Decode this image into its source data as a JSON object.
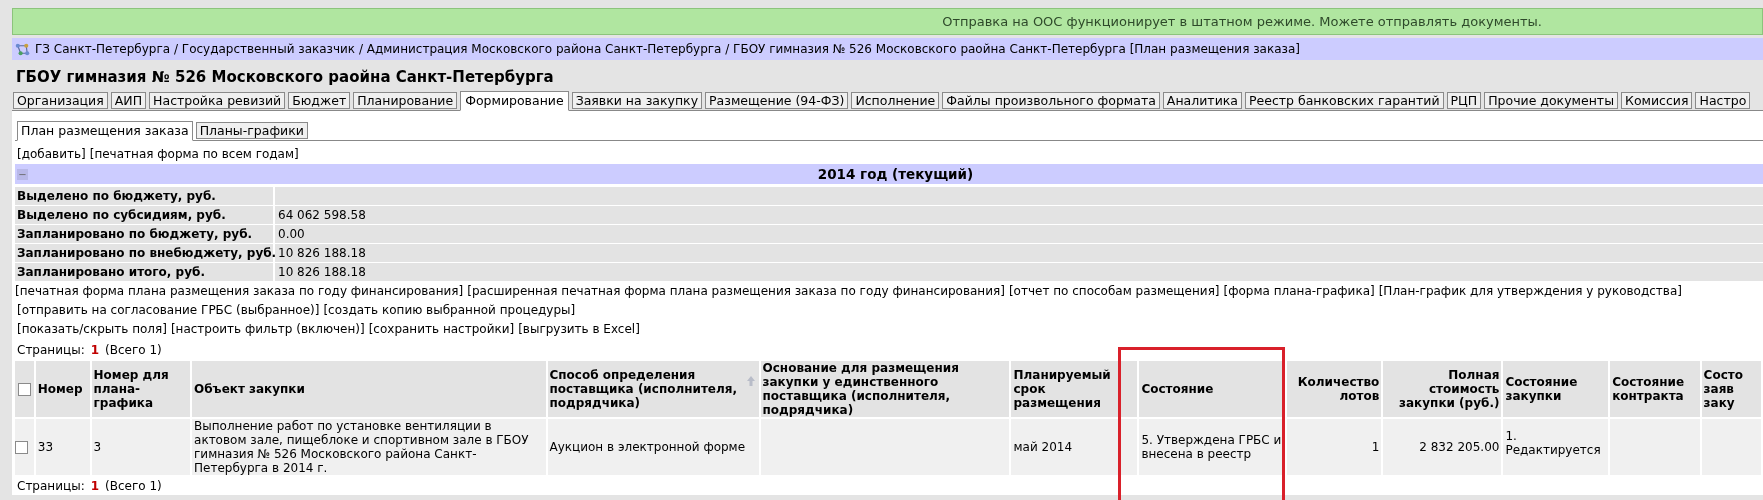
{
  "notice": "Отправка на ООС функционирует в штатном режиме. Можете отправлять документы.",
  "breadcrumb": "ГЗ Санкт-Петербурга / Государственный заказчик / Администрация Московского района Санкт-Петербурга / ГБОУ гимназия № 526 Московского раойна Санкт-Петербурга [План размещения заказа]",
  "org_title": "ГБОУ гимназия № 526 Московского раойна Санкт-Петербурга",
  "tabs": [
    {
      "label": "Организация",
      "selected": false
    },
    {
      "label": "АИП",
      "selected": false
    },
    {
      "label": "Настройка ревизий",
      "selected": false
    },
    {
      "label": "Бюджет",
      "selected": false
    },
    {
      "label": "Планирование",
      "selected": false
    },
    {
      "label": "Формирование",
      "selected": true
    },
    {
      "label": "Заявки на закупку",
      "selected": false
    },
    {
      "label": "Размещение (94-ФЗ)",
      "selected": false
    },
    {
      "label": "Исполнение",
      "selected": false
    },
    {
      "label": "Файлы произвольного формата",
      "selected": false
    },
    {
      "label": "Аналитика",
      "selected": false
    },
    {
      "label": "Реестр банковских гарантий",
      "selected": false
    },
    {
      "label": "РЦП",
      "selected": false
    },
    {
      "label": "Прочие документы",
      "selected": false
    },
    {
      "label": "Комиссия",
      "selected": false
    },
    {
      "label": "Настро",
      "selected": false
    }
  ],
  "subtabs": [
    {
      "label": "План размещения заказа",
      "selected": true
    },
    {
      "label": "Планы-графики",
      "selected": false
    }
  ],
  "top_links": [
    "[добавить]",
    "[печатная форма по всем годам]"
  ],
  "year_section": {
    "collapse_glyph": "−",
    "title": "2014 год (текущий)",
    "summary": [
      {
        "label": "Выделено по бюджету, руб."
      },
      {
        "label": "Выделено по субсидиям, руб.",
        "value": "64 062 598.58"
      },
      {
        "label": "Запланировано по бюджету, руб.",
        "value": "0.00"
      },
      {
        "label": "Запланировано по внебюджету, руб.",
        "value": "10 826 188.18"
      },
      {
        "label": "Запланировано итого, руб.",
        "value": "10 826 188.18"
      }
    ]
  },
  "link_rows": [
    [
      "[печатная форма плана размещения заказа по году финансирования]",
      "[расширенная печатная форма плана размещения заказа по году финансирования]",
      "[отчет по способам размещения]",
      "[форма плана-графика]",
      "[План-график для утверждения у руководства]"
    ],
    [
      "[отправить на согласование ГРБС (выбранное)]",
      "[создать копию выбранной процедуры]"
    ],
    [
      "[показать/скрыть поля]",
      "[настроить фильтр (включен)]",
      "[сохранить настройки]",
      "[выгрузить в Excel]"
    ]
  ],
  "pager_top": {
    "label": "Страницы:",
    "current": "1",
    "total": "(Всего 1)"
  },
  "table": {
    "select_all_checked": false,
    "columns": [
      {
        "label": "Номер",
        "highlighted": false,
        "sorted": false
      },
      {
        "label": "Номер для плана-графика",
        "highlighted": false,
        "sorted": false
      },
      {
        "label": "Объект закупки",
        "highlighted": false,
        "sorted": false
      },
      {
        "label": "Способ определения поставщика (исполнителя, подрядчика)",
        "highlighted": false,
        "sorted": true
      },
      {
        "label": "Основание для размещения закупки у единственного поставщика (исполнителя, подрядчика)",
        "highlighted": false,
        "sorted": false
      },
      {
        "label": "Планируемый срок размещения",
        "highlighted": false,
        "sorted": false
      },
      {
        "label": "Состояние",
        "highlighted": true,
        "sorted": false
      },
      {
        "label": "Количество лотов",
        "highlighted": false,
        "sorted": false
      },
      {
        "label": "Полная стоимость закупки (руб.)",
        "highlighted": false,
        "sorted": false
      },
      {
        "label": "Состояние закупки",
        "highlighted": false,
        "sorted": false
      },
      {
        "label": "Состояние контракта",
        "highlighted": false,
        "sorted": false
      },
      {
        "label": "Состо\nзаяв\nзаку",
        "highlighted": false,
        "sorted": false
      }
    ],
    "rows": [
      {
        "checked": false,
        "cells": [
          "33",
          "3",
          "Выполнение работ по установке вентиляции в актовом зале, пищеблоке и спортивном зале в ГБОУ гимназия № 526 Московского района Санкт-Петербурга в 2014 г.",
          "Аукцион в электронной форме",
          "",
          "май 2014",
          "5. Утверждена ГРБС и внесена в реестр",
          "1",
          "2 832 205.00",
          "1. Редактируется",
          "",
          ""
        ]
      }
    ]
  },
  "pager_bottom": {
    "label": "Страницы:",
    "current": "1",
    "total": "(Всего 1)"
  }
}
